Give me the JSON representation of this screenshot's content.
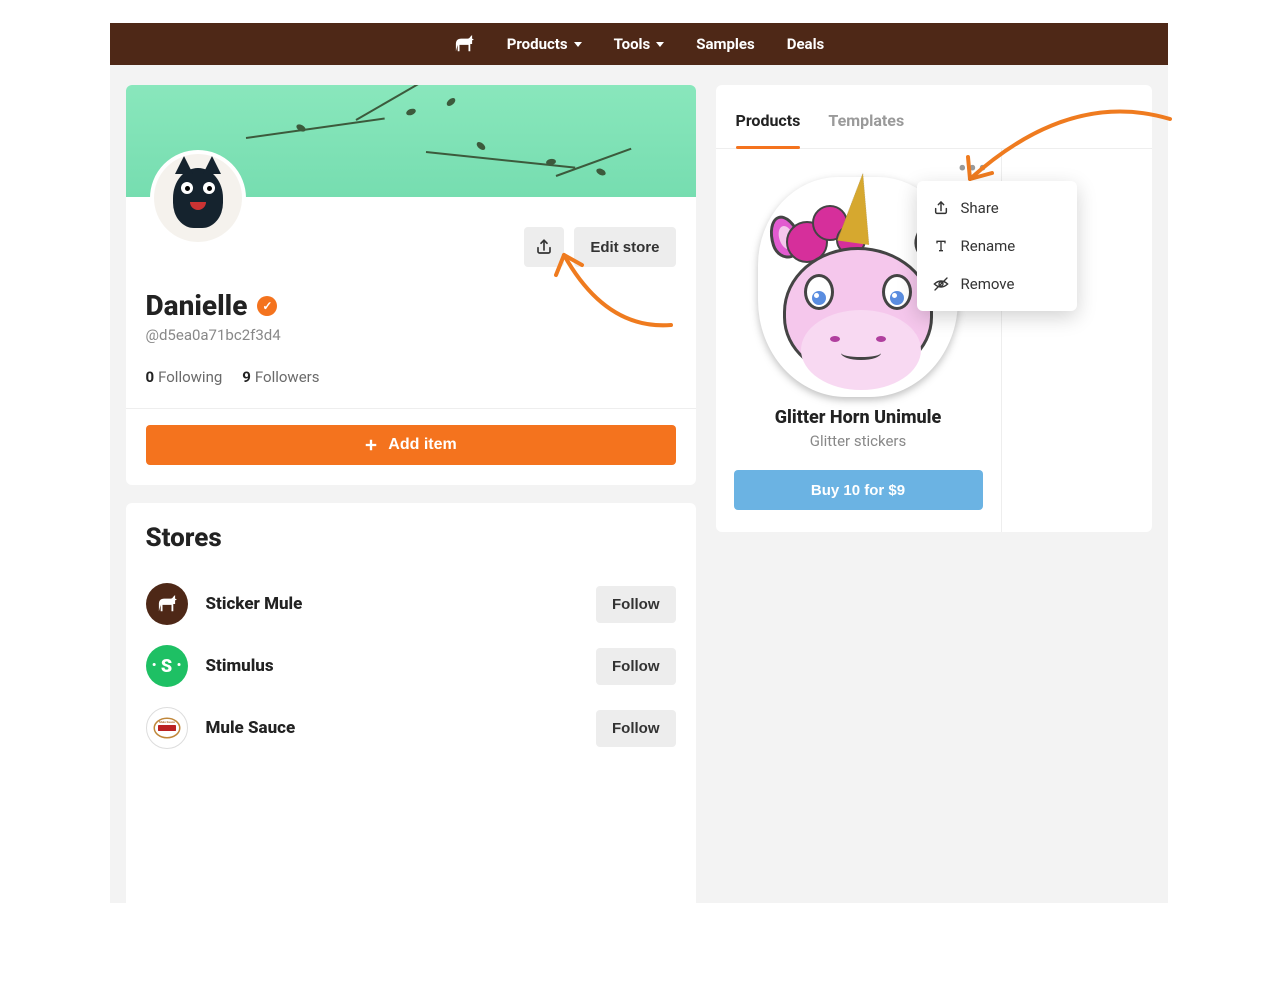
{
  "nav": {
    "products": "Products",
    "tools": "Tools",
    "samples": "Samples",
    "deals": "Deals"
  },
  "profile": {
    "edit_store": "Edit store",
    "name": "Danielle",
    "handle": "@d5ea0a71bc2f3d4",
    "following_count": "0",
    "following_label": "Following",
    "followers_count": "9",
    "followers_label": "Followers",
    "add_item": "Add item"
  },
  "stores": {
    "title": "Stores",
    "follow_label": "Follow",
    "items": [
      {
        "name": "Sticker Mule"
      },
      {
        "name": "Stimulus"
      },
      {
        "name": "Mule Sauce"
      }
    ]
  },
  "right": {
    "tabs": {
      "products": "Products",
      "templates": "Templates"
    },
    "product": {
      "title": "Glitter Horn Unimule",
      "subtitle": "Glitter stickers",
      "buy": "Buy 10 for $9"
    },
    "menu": {
      "share": "Share",
      "rename": "Rename",
      "remove": "Remove"
    }
  }
}
